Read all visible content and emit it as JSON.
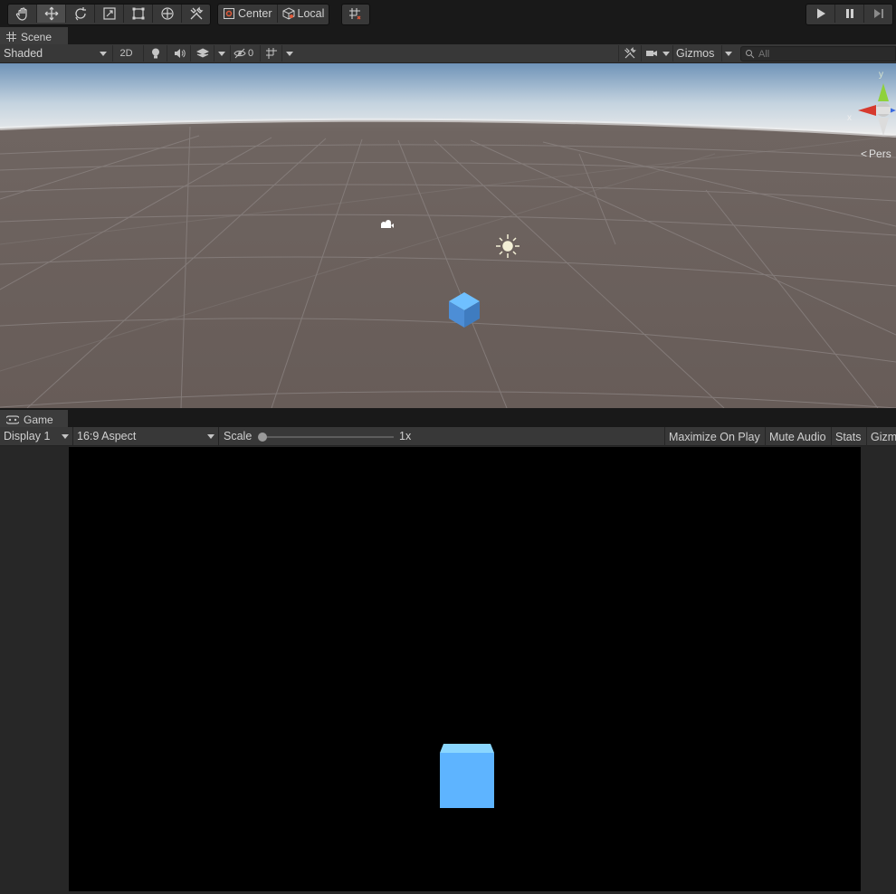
{
  "toolbar": {
    "tools": [
      {
        "name": "hand-tool",
        "icon": "hand-icon"
      },
      {
        "name": "move-tool",
        "icon": "move-icon",
        "active": true
      },
      {
        "name": "rotate-tool",
        "icon": "rotate-icon"
      },
      {
        "name": "scale-tool",
        "icon": "scale-icon"
      },
      {
        "name": "rect-tool",
        "icon": "rect-icon"
      },
      {
        "name": "transform-tool",
        "icon": "transform-icon"
      },
      {
        "name": "custom-tool",
        "icon": "tools-icon"
      }
    ],
    "pivot_label": "Center",
    "space_label": "Local",
    "play_icon": "play-icon",
    "pause_icon": "pause-icon",
    "step_icon": "step-icon"
  },
  "scene": {
    "tab_label": "Scene",
    "shading_mode": "Shaded",
    "mode_2d_label": "2D",
    "hidden_count": "0",
    "gizmos_label": "Gizmos",
    "search_placeholder": "All",
    "projection_label": "Pers",
    "axis_y": "y",
    "axis_x": "x"
  },
  "game": {
    "tab_label": "Game",
    "display_label": "Display 1",
    "aspect_label": "16:9 Aspect",
    "scale_label": "Scale",
    "scale_value": "1x",
    "maximize_label": "Maximize On Play",
    "mute_label": "Mute Audio",
    "stats_label": "Stats",
    "gizmos_label": "Gizmos"
  },
  "colors": {
    "accent_active": "#4d4d4d",
    "panel": "#383838",
    "cube": "#5eb4ff",
    "ground": "#6c625e"
  }
}
